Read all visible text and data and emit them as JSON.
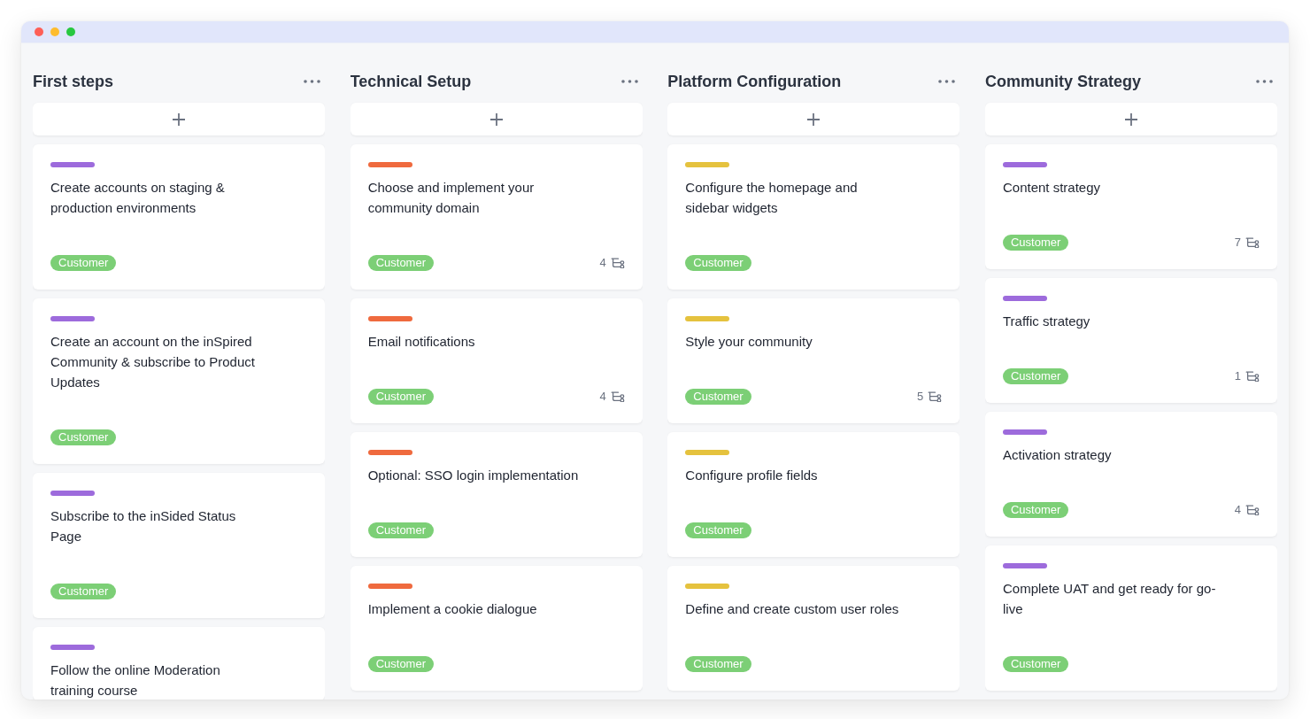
{
  "columns": [
    {
      "title": "First steps",
      "cards": [
        {
          "color": "#9d6bdc",
          "title_lines": [
            "Create accounts on staging &",
            "production environments"
          ],
          "tag": "Customer"
        },
        {
          "color": "#9d6bdc",
          "title_lines": [
            "Create an account on the inSpired",
            "Community & subscribe to Product",
            "Updates"
          ],
          "tag": "Customer"
        },
        {
          "color": "#9d6bdc",
          "title_lines": [
            "Subscribe to the inSided Status",
            "Page"
          ],
          "tag": "Customer"
        },
        {
          "color": "#9d6bdc",
          "title_lines": [
            "Follow the online Moderation",
            "training course"
          ]
        }
      ]
    },
    {
      "title": "Technical Setup",
      "cards": [
        {
          "color": "#ef6a3e",
          "title_lines": [
            "Choose and implement your",
            "community domain"
          ],
          "tag": "Customer",
          "subtasks": "4"
        },
        {
          "color": "#ef6a3e",
          "title_lines": [
            "Email notifications"
          ],
          "tag": "Customer",
          "subtasks": "4"
        },
        {
          "color": "#ef6a3e",
          "title_lines": [
            "Optional: SSO login implementation"
          ],
          "tag": "Customer"
        },
        {
          "color": "#ef6a3e",
          "title_lines": [
            "Implement a cookie dialogue"
          ],
          "tag": "Customer"
        }
      ]
    },
    {
      "title": "Platform Configuration",
      "cards": [
        {
          "color": "#e5c23e",
          "title_lines": [
            "Configure the homepage and",
            "sidebar widgets"
          ],
          "tag": "Customer"
        },
        {
          "color": "#e5c23e",
          "title_lines": [
            "Style your community"
          ],
          "tag": "Customer",
          "subtasks": "5"
        },
        {
          "color": "#e5c23e",
          "title_lines": [
            "Configure profile fields"
          ],
          "tag": "Customer"
        },
        {
          "color": "#e5c23e",
          "title_lines": [
            "Define and create custom user roles"
          ],
          "tag": "Customer"
        }
      ]
    },
    {
      "title": "Community Strategy",
      "cards": [
        {
          "color": "#9d6bdc",
          "title_lines": [
            "Content strategy"
          ],
          "tag": "Customer",
          "subtasks": "7"
        },
        {
          "color": "#9d6bdc",
          "title_lines": [
            "Traffic strategy"
          ],
          "tag": "Customer",
          "subtasks": "1"
        },
        {
          "color": "#9d6bdc",
          "title_lines": [
            "Activation strategy"
          ],
          "tag": "Customer",
          "subtasks": "4"
        },
        {
          "color": "#9d6bdc",
          "title_lines": [
            "Complete UAT and get ready for go-",
            "live"
          ],
          "tag": "Customer"
        }
      ]
    }
  ]
}
